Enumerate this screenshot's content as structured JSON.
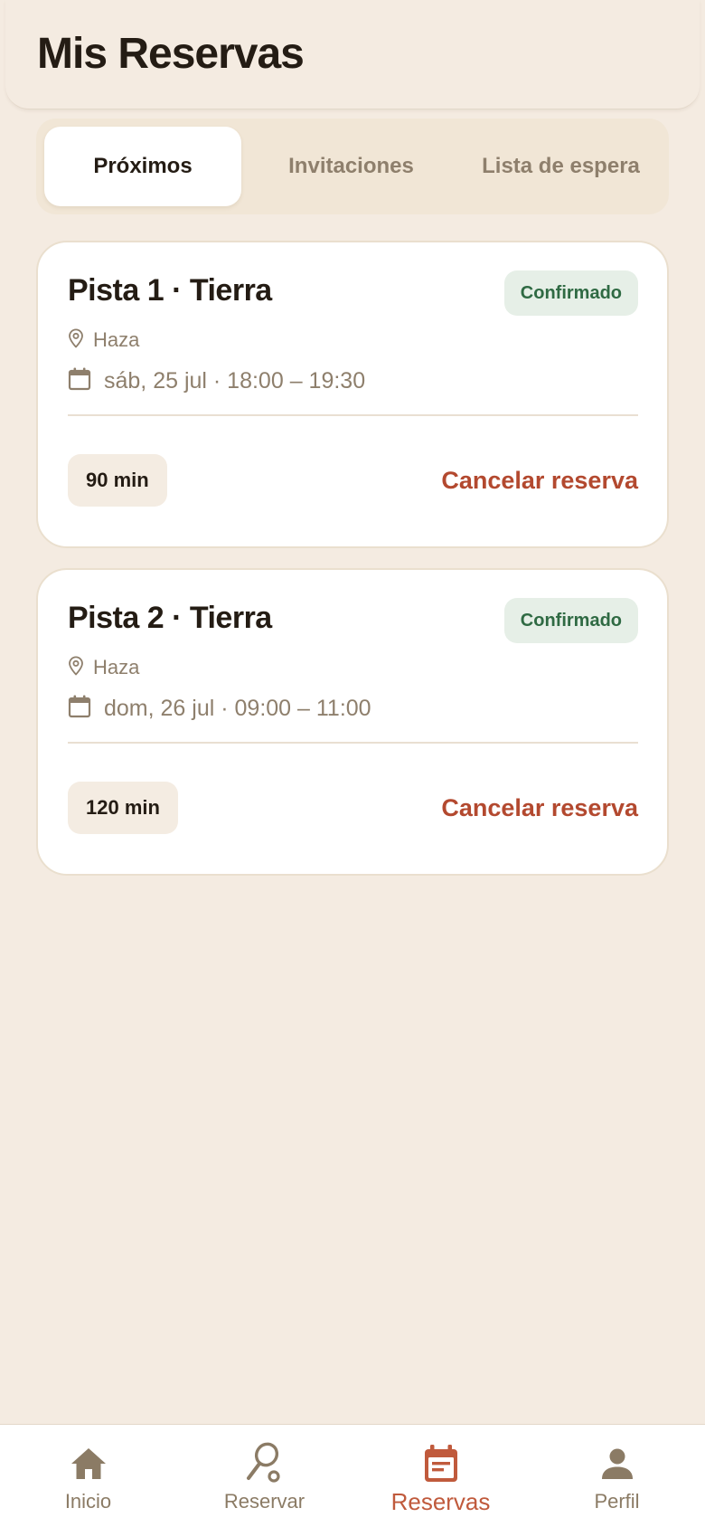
{
  "header": {
    "title": "Mis Reservas"
  },
  "tabs": [
    {
      "label": "Próximos",
      "active": true
    },
    {
      "label": "Invitaciones",
      "active": false
    },
    {
      "label": "Lista de espera",
      "active": false
    }
  ],
  "bookings": [
    {
      "title": "Pista 1 · Tierra",
      "status": "Confirmado",
      "location": "Haza",
      "datetime": "sáb, 25 jul · 18:00 – 19:30",
      "duration": "90 min",
      "cancel_label": "Cancelar reserva",
      "location_icon": "map-pin-icon",
      "date_icon": "calendar-icon"
    },
    {
      "title": "Pista 2 · Tierra",
      "status": "Confirmado",
      "location": "Haza",
      "datetime": "dom, 26 jul · 09:00 – 11:00",
      "duration": "120 min",
      "cancel_label": "Cancelar reserva",
      "location_icon": "map-pin-icon",
      "date_icon": "calendar-icon"
    }
  ],
  "nav": [
    {
      "label": "Inicio",
      "icon": "home-icon",
      "active": false
    },
    {
      "label": "Reservar",
      "icon": "racket-icon",
      "active": false
    },
    {
      "label": "Reservas",
      "icon": "calendar-icon",
      "active": true
    },
    {
      "label": "Perfil",
      "icon": "user-icon",
      "active": false
    }
  ],
  "colors": {
    "background": "#f4ebe1",
    "accent": "#c05a3c",
    "cancel": "#b3492f",
    "status_text": "#2f6a43",
    "status_bg": "#e6efe7",
    "muted_text": "#8e7f6c",
    "nav_icon": "#8b7b65"
  }
}
